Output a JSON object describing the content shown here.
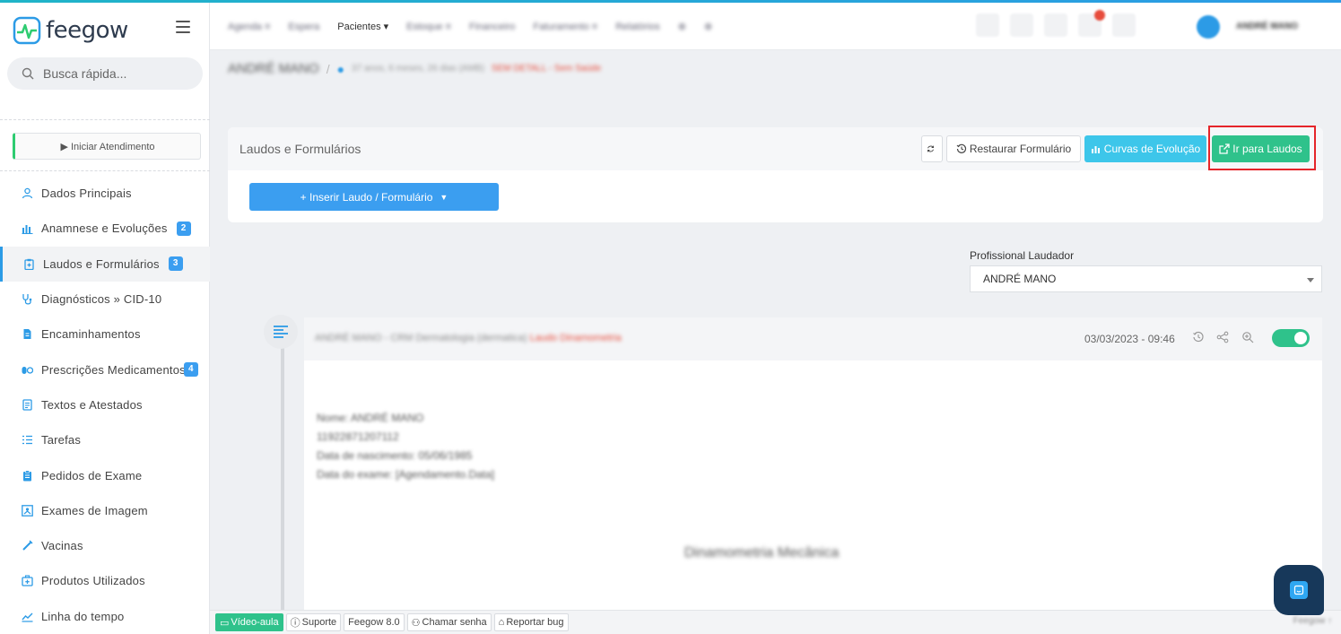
{
  "app": {
    "logo_text": "feegow"
  },
  "search": {
    "placeholder": "Busca rápida..."
  },
  "sidebar": {
    "start_button": "▶ Iniciar Atendimento",
    "items": [
      {
        "label": "Dados Principais",
        "icon": "user-icon"
      },
      {
        "label": "Anamnese e Evoluções",
        "icon": "chart-icon",
        "badge": "2"
      },
      {
        "label": "Laudos e Formulários",
        "icon": "clipboard-icon",
        "badge": "3",
        "active": true
      },
      {
        "label": "Diagnósticos » CID-10",
        "icon": "stethoscope-icon"
      },
      {
        "label": "Encaminhamentos",
        "icon": "document-icon"
      },
      {
        "label": "Prescrições Medicamentos",
        "icon": "pills-icon",
        "badge": "4"
      },
      {
        "label": "Textos e Atestados",
        "icon": "file-text-icon"
      },
      {
        "label": "Tarefas",
        "icon": "tasks-icon"
      },
      {
        "label": "Pedidos de Exame",
        "icon": "clipboard-list-icon"
      },
      {
        "label": "Exames de Imagem",
        "icon": "image-exam-icon"
      },
      {
        "label": "Vacinas",
        "icon": "syringe-icon"
      },
      {
        "label": "Produtos Utilizados",
        "icon": "first-aid-icon"
      },
      {
        "label": "Linha do tempo",
        "icon": "timeline-chart-icon"
      }
    ]
  },
  "topnav": {
    "items": [
      "Agenda ≡",
      "Espera",
      "Pacientes ▾",
      "Estoque ≡",
      "Financeiro",
      "Faturamento ≡",
      "Relatórios",
      "⊕",
      "⊕"
    ],
    "user_name": "ANDRÉ MANO"
  },
  "breadcrumb": {
    "patient_name": "ANDRÉ MANO",
    "info": "37 anos, 6 meses, 26 dias (AMB)",
    "tags": "SEM DETALL - Sem Saúde"
  },
  "panel": {
    "title": "Laudos e Formulários",
    "restore_label": "Restaurar Formulário",
    "curvas_label": "Curvas de Evolução",
    "ir_label": "Ir para Laudos",
    "insert_label": "+ Inserir Laudo / Formulário"
  },
  "profissional": {
    "label": "Profissional Laudador",
    "value": "ANDRÉ MANO"
  },
  "card": {
    "title": "ANDRÉ MANO - CRM Dermatologia (dermatica)",
    "title_red": "Laudo Dinamometria",
    "date": "03/03/2023 - 09:46",
    "body": [
      "Nome: ANDRÉ MANO",
      "11922871207112",
      "Data de nascimento: 05/06/1985",
      "Data do exame: [Agendamento.Data]"
    ],
    "center_title": "Dinamometria Mecânica"
  },
  "bottombar": {
    "items": [
      "Vídeo-aula",
      "Suporte",
      "Feegow 8.0",
      "Chamar senha",
      "Reportar bug"
    ],
    "right": "Feegow"
  },
  "colors": {
    "primary": "#3b9ef0",
    "green": "#2fc28b",
    "cyan": "#3dc6ea",
    "highlight": "#e5252a"
  }
}
